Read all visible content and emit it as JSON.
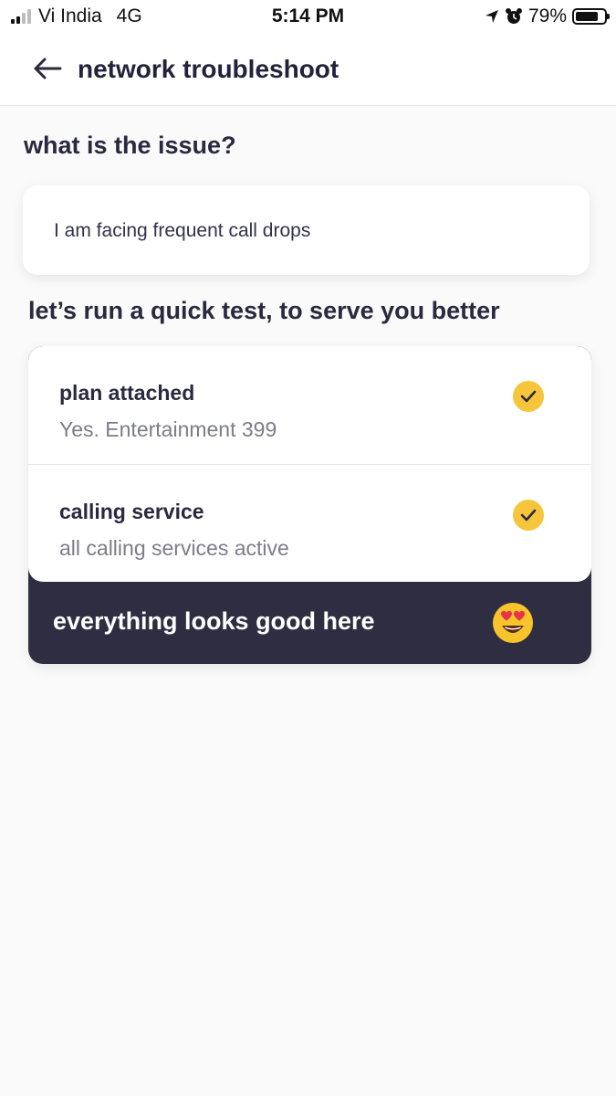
{
  "status_bar": {
    "carrier": "Vi India",
    "network": "4G",
    "time": "5:14 PM",
    "battery": "79%",
    "battery_level": 0.79,
    "signal_bars": 2
  },
  "header": {
    "title": "network troubleshoot",
    "back_icon": "back-arrow-icon"
  },
  "issue": {
    "heading": "what is the issue?",
    "text": "I am facing frequent call drops"
  },
  "test": {
    "heading": "let’s run a quick test, to serve you better",
    "items": [
      {
        "title": "plan attached",
        "subtitle": "Yes. Entertainment 399",
        "status_icon": "check-icon"
      },
      {
        "title": "calling service",
        "subtitle": "all calling services active",
        "status_icon": "check-icon"
      }
    ],
    "summary": "everything looks good here",
    "summary_icon": "heart-eyes-emoji-icon"
  },
  "colors": {
    "accent": "#f5c63b",
    "banner": "#2f2d42",
    "text": "#2a293f"
  }
}
